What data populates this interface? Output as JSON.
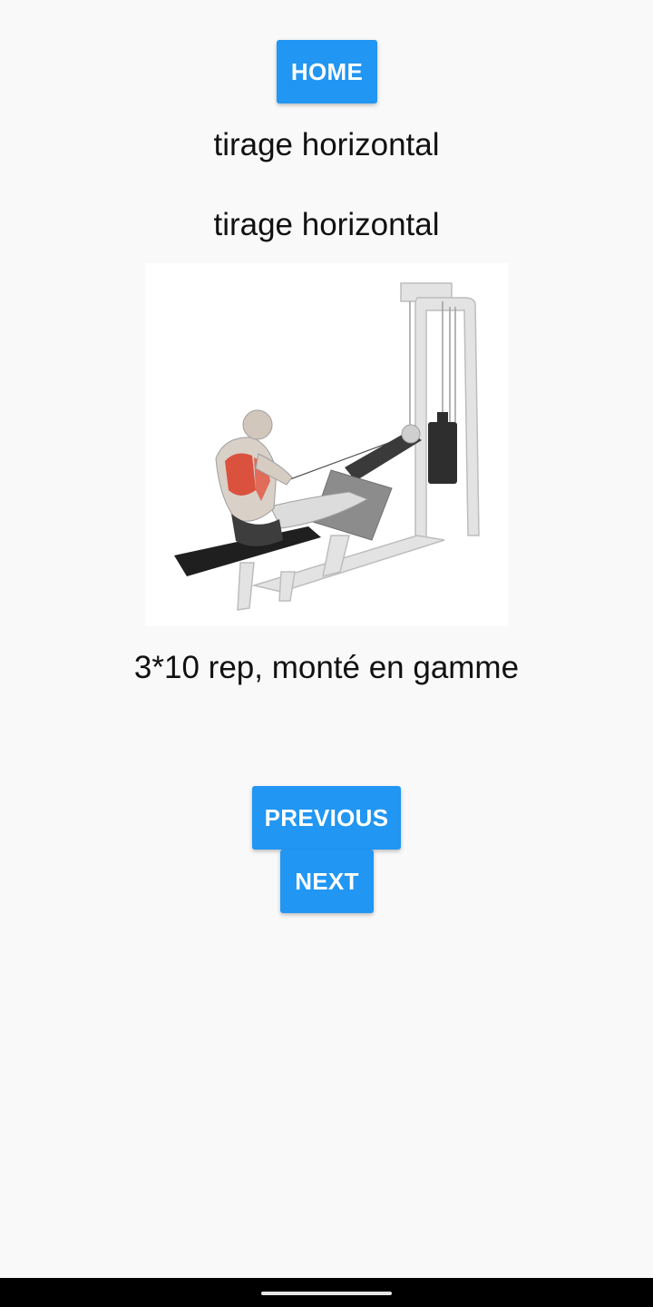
{
  "header": {
    "home_label": "HOME"
  },
  "exercise": {
    "name": "tirage horizontal",
    "subtitle": "tirage horizontal",
    "instructions": "3*10 rep, monté en gamme"
  },
  "navigation": {
    "previous_label": "PREVIOUS",
    "next_label": "NEXT"
  },
  "colors": {
    "accent": "#2196f3",
    "background": "#f9f9f9",
    "muscle_highlight": "#d9432f"
  },
  "icons": {
    "exercise_image": "seated-cable-row-illustration"
  }
}
